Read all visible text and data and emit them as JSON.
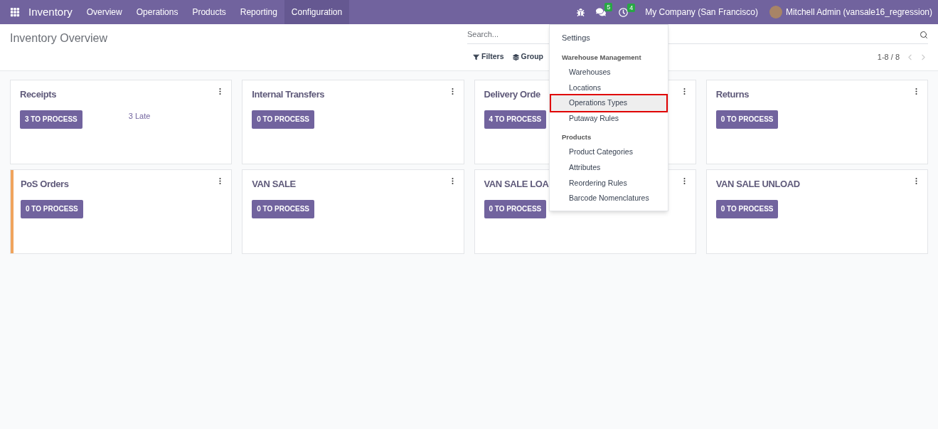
{
  "navbar": {
    "app_name": "Inventory",
    "menus": [
      {
        "label": "Overview",
        "selected": false
      },
      {
        "label": "Operations",
        "selected": false
      },
      {
        "label": "Products",
        "selected": false
      },
      {
        "label": "Reporting",
        "selected": false
      },
      {
        "label": "Configuration",
        "selected": true
      }
    ],
    "messages_badge": "5",
    "activities_badge": "4",
    "company": "My Company (San Francisco)",
    "user": "Mitchell Admin (vansale16_regression)"
  },
  "control_panel": {
    "title": "Inventory Overview",
    "search": {
      "placeholder": "Search..."
    },
    "filters": "Filters",
    "group_by": "Group",
    "pager": "1-8 / 8"
  },
  "cards": [
    {
      "title": "Receipts",
      "button": "3 TO PROCESS",
      "late": "3 Late"
    },
    {
      "title": "Internal Transfers",
      "button": "0 TO PROCESS"
    },
    {
      "title": "Delivery Orde",
      "button": "4 TO PROCESS"
    },
    {
      "title": "Returns",
      "button": "0 TO PROCESS"
    },
    {
      "title": "PoS Orders",
      "button": "0 TO PROCESS",
      "color": "#f0a45d"
    },
    {
      "title": "VAN SALE",
      "button": "0 TO PROCESS"
    },
    {
      "title": "VAN SALE LOA",
      "button": "0 TO PROCESS"
    },
    {
      "title": "VAN SALE UNLOAD",
      "button": "0 TO PROCESS"
    }
  ],
  "config_menu": [
    {
      "kind": "item",
      "label": "Settings",
      "selected": false
    },
    {
      "kind": "header",
      "label": "Warehouse Management"
    },
    {
      "kind": "subitem",
      "label": "Warehouses",
      "selected": false
    },
    {
      "kind": "subitem",
      "label": "Locations",
      "selected": false
    },
    {
      "kind": "subitem",
      "label": "Operations Types",
      "selected": true
    },
    {
      "kind": "subitem",
      "label": "Putaway Rules",
      "selected": false
    },
    {
      "kind": "header",
      "label": "Products"
    },
    {
      "kind": "subitem",
      "label": "Product Categories",
      "selected": false
    },
    {
      "kind": "subitem",
      "label": "Attributes",
      "selected": false
    },
    {
      "kind": "subitem",
      "label": "Reordering Rules",
      "selected": false
    },
    {
      "kind": "subitem",
      "label": "Barcode Nomenclatures",
      "selected": false
    }
  ]
}
